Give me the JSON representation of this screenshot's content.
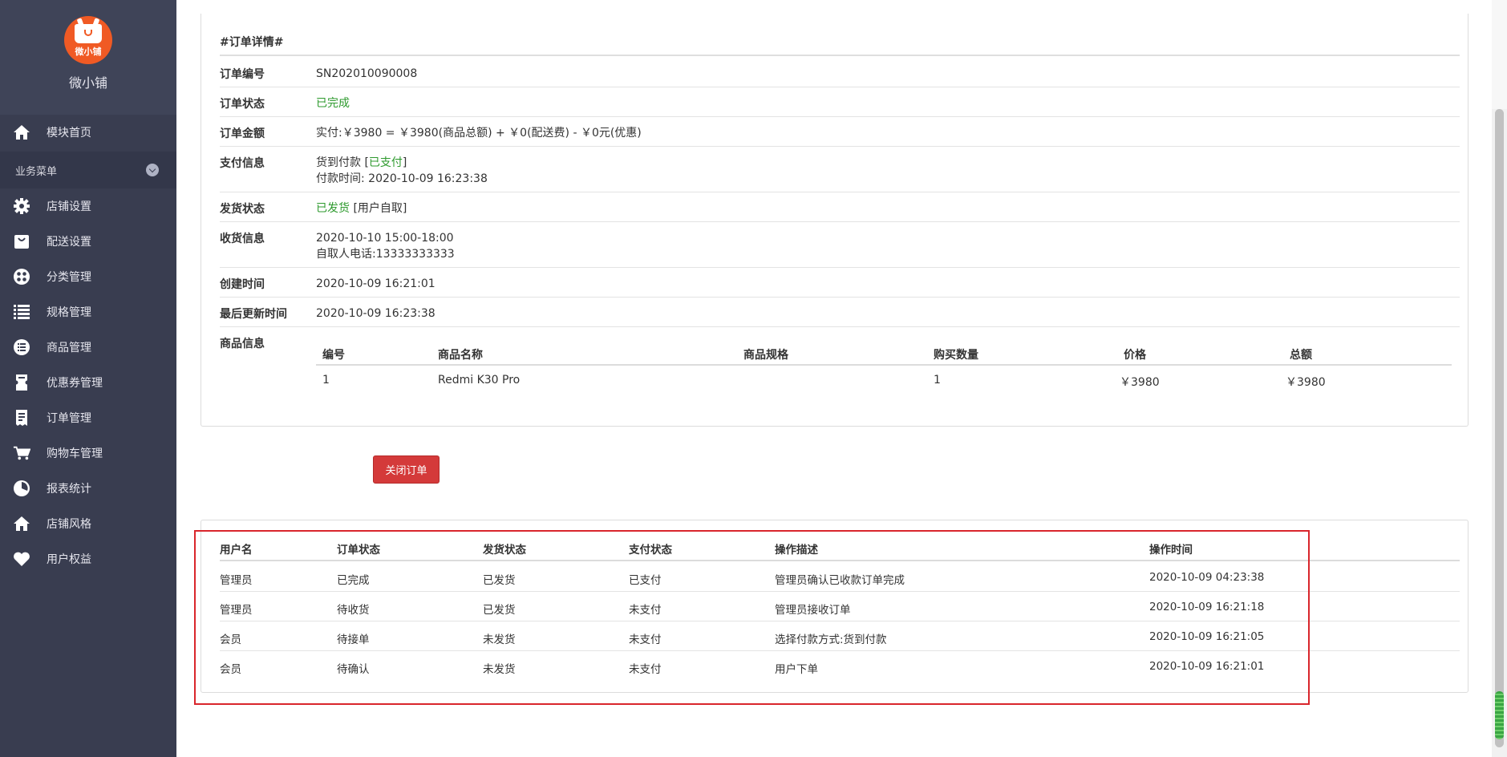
{
  "sidebar": {
    "logo_text": "微小铺",
    "brand_name": "微小铺",
    "home": "模块首页",
    "group_label": "业务菜单",
    "items": [
      {
        "label": "店铺设置",
        "icon": "gear-icon"
      },
      {
        "label": "配送设置",
        "icon": "bag-icon"
      },
      {
        "label": "分类管理",
        "icon": "grid-icon"
      },
      {
        "label": "规格管理",
        "icon": "list-icon"
      },
      {
        "label": "商品管理",
        "icon": "list-circle-icon"
      },
      {
        "label": "优惠券管理",
        "icon": "ticket-icon"
      },
      {
        "label": "订单管理",
        "icon": "receipt-icon"
      },
      {
        "label": "购物车管理",
        "icon": "cart-icon"
      },
      {
        "label": "报表统计",
        "icon": "pie-chart-icon"
      },
      {
        "label": "店铺风格",
        "icon": "house-icon"
      },
      {
        "label": "用户权益",
        "icon": "heart-icon"
      }
    ]
  },
  "order": {
    "heading": "#订单详情#",
    "order_no_label": "订单编号",
    "order_no": "SN202010090008",
    "status_label": "订单状态",
    "status": "已完成",
    "amount_label": "订单金额",
    "amount": "实付:￥3980 = ￥3980(商品总额) + ￥0(配送费) - ￥0元(优惠)",
    "payment_label": "支付信息",
    "payment_method": "货到付款 [",
    "payment_status": "已支付",
    "payment_close": "]",
    "payment_time": "付款时间: 2020-10-09 16:23:38",
    "shipping_label": "发货状态",
    "shipping_status": "已发货",
    "shipping_method": " [用户自取]",
    "receive_label": "收货信息",
    "receive_time": "2020-10-10 15:00-18:00",
    "receive_phone": "自取人电话:13333333333",
    "created_label": "创建时间",
    "created": "2020-10-09 16:21:01",
    "updated_label": "最后更新时间",
    "updated": "2020-10-09 16:23:38",
    "goods_label": "商品信息",
    "goods_headers": [
      "编号",
      "商品名称",
      "商品规格",
      "购买数量",
      "价格",
      "总额"
    ],
    "goods_rows": [
      [
        "1",
        "Redmi K30 Pro",
        "",
        "1",
        "￥3980",
        "￥3980"
      ]
    ]
  },
  "close_button": "关闭订单",
  "log": {
    "headers": [
      "用户名",
      "订单状态",
      "发货状态",
      "支付状态",
      "操作描述",
      "操作时间"
    ],
    "rows": [
      [
        "管理员",
        "已完成",
        "已发货",
        "已支付",
        "管理员确认已收款订单完成",
        "2020-10-09 04:23:38"
      ],
      [
        "管理员",
        "待收货",
        "已发货",
        "未支付",
        "管理员接收订单",
        "2020-10-09 16:21:18"
      ],
      [
        "会员",
        "待接单",
        "未发货",
        "未支付",
        "选择付款方式:货到付款",
        "2020-10-09 16:21:05"
      ],
      [
        "会员",
        "待确认",
        "未发货",
        "未支付",
        "用户下单",
        "2020-10-09 16:21:01"
      ]
    ]
  },
  "colors": {
    "sidebar_bg": "#393d50",
    "accent_green": "#2e9a2e",
    "danger": "#d43a3a",
    "highlight": "#d9262c"
  }
}
